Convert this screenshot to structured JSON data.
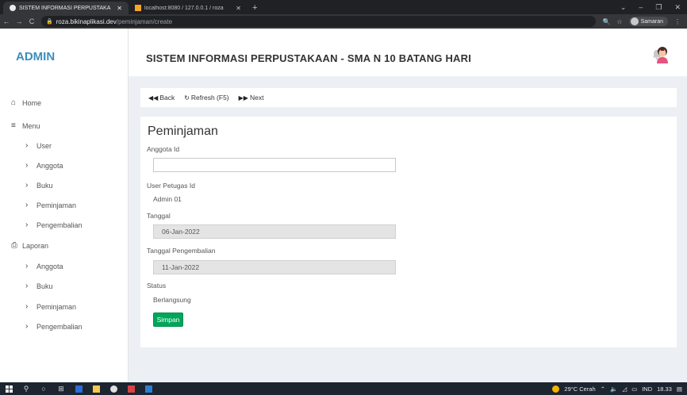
{
  "browser": {
    "tabs": [
      {
        "title": "SISTEM INFORMASI PERPUSTAKA",
        "close": "✕",
        "active": true
      },
      {
        "title": "localhost:8080 / 127.0.0.1 / roza",
        "close": "✕",
        "active": false
      }
    ],
    "new_tab": "+",
    "window_controls": {
      "dropdown": "⌄",
      "minimize": "–",
      "restore": "❐",
      "close": "✕"
    },
    "url_host": "roza.bikinaplikasi.dev",
    "url_path": "/peminjaman/create",
    "profile_name": "Samaran"
  },
  "app": {
    "brand": "ADMIN",
    "title": "SISTEM INFORMASI PERPUSTAKAAN - SMA N 10 BATANG HARI"
  },
  "sidebar": {
    "home": "Home",
    "menu": "Menu",
    "menu_items": [
      "User",
      "Anggota",
      "Buku",
      "Peminjaman",
      "Pengembalian"
    ],
    "laporan": "Laporan",
    "laporan_items": [
      "Anggota",
      "Buku",
      "Peminjaman",
      "Pengembalian"
    ]
  },
  "toolbar": {
    "back": "Back",
    "refresh": "Refresh (F5)",
    "next": "Next"
  },
  "form": {
    "heading": "Peminjaman",
    "anggota_label": "Anggota Id",
    "anggota_value": "",
    "petugas_label": "User Petugas Id",
    "petugas_value": "Admin 01",
    "tanggal_label": "Tanggal",
    "tanggal_value": "06-Jan-2022",
    "pengembalian_label": "Tanggal Pengembalian",
    "pengembalian_value": "11-Jan-2022",
    "status_label": "Status",
    "status_value": "Berlangsung",
    "save_label": "Simpan"
  },
  "taskbar": {
    "weather": "29°C Cerah",
    "lang": "IND",
    "time": "18.33"
  },
  "colors": {
    "brand": "#3c8dbc",
    "save": "#00a65a",
    "content_bg": "#ecf0f5"
  }
}
